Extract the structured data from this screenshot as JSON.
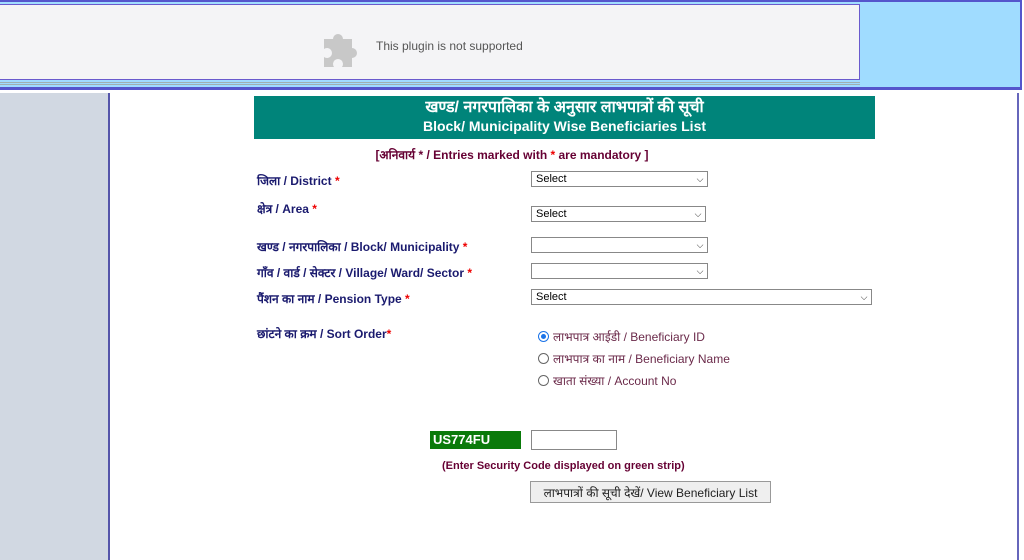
{
  "plugin": {
    "icon": "puzzle-piece-icon",
    "message": "This plugin is not supported"
  },
  "header": {
    "title_hindi": "खण्ड/ नगरपालिका के अनुसार लाभपात्रों की सूची",
    "title_english": "Block/ Municipality Wise Beneficiaries List"
  },
  "mandatory_note": {
    "prefix": "[अनिवार्य * / Entries marked with ",
    "star": "*",
    "suffix": " are mandatory ]"
  },
  "form": {
    "district": {
      "label": "जिला / District",
      "star": "*",
      "value": "Select"
    },
    "area": {
      "label": "क्षेत्र / Area",
      "star": "*",
      "value": "Select"
    },
    "block": {
      "label": "खण्ड / नगरपालिका / Block/ Municipality",
      "star": "*",
      "value": ""
    },
    "village": {
      "label": "गाँव / वार्ड / सेक्टर / Village/ Ward/ Sector",
      "star": "*",
      "value": ""
    },
    "pension": {
      "label": "पैंशन का नाम / Pension Type",
      "star": "*",
      "value": "Select"
    },
    "sort": {
      "label": "छांटने का क्रम / Sort Order",
      "star": "*",
      "options": [
        {
          "label": "लाभपात्र आईडी / Beneficiary ID",
          "selected": true
        },
        {
          "label": "लाभपात्र का नाम / Beneficiary Name",
          "selected": false
        },
        {
          "label": "खाता संख्या / Account No",
          "selected": false
        }
      ]
    },
    "captcha": {
      "code": "US774FU",
      "input_value": "",
      "hint": "(Enter Security Code displayed on green strip)"
    },
    "submit_label": "लाभपात्रों की सूची देखें/ View Beneficiary List"
  },
  "colors": {
    "header_bg": "#00847a",
    "captcha_bg": "#0a7a0a",
    "label": "#1a1a6e",
    "required": "#ee0000"
  }
}
